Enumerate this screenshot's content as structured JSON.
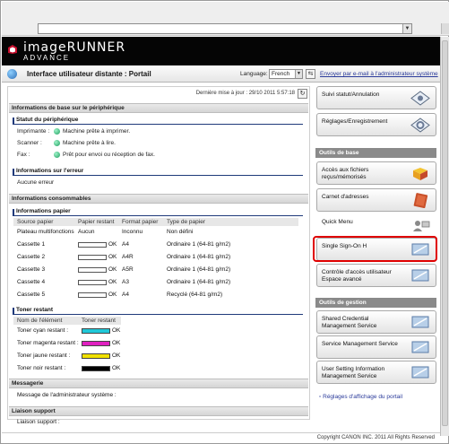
{
  "app": {
    "logo_main": "imageRUNNER",
    "logo_sub": "ADVANCE",
    "page_title": "Interface utilisateur distante : Portail",
    "language_label": "Language:",
    "language_value": "French",
    "email_link": "Envoyer par e-mail à l'administrateur système"
  },
  "left": {
    "last_update": "Dernière mise à jour : 29/10 2011 5:57:18",
    "device_info": {
      "heading": "Informations de base sur le périphérique",
      "status_heading": "Statut du périphérique",
      "rows": [
        {
          "label": "Imprimante :",
          "status": "Machine prête à imprimer."
        },
        {
          "label": "Scanner :",
          "status": "Machine prête à lire."
        },
        {
          "label": "Fax :",
          "status": "Prêt pour envoi ou réception de fax."
        }
      ],
      "error_heading": "Informations sur l'erreur",
      "error_text": "Aucune erreur"
    },
    "consumables": {
      "heading": "Informations consommables",
      "paper_heading": "Informations papier",
      "columns": [
        "Source papier",
        "Papier restant",
        "Format papier",
        "Type de papier"
      ],
      "rows": [
        {
          "source": "Plateau multifonctions",
          "remaining": "Aucun",
          "format": "Inconnu",
          "type": "Non défini",
          "level": null
        },
        {
          "source": "Cassette 1",
          "remaining": "OK",
          "format": "A4",
          "type": "Ordinaire 1 (64-81 g/m2)",
          "level": 1.0
        },
        {
          "source": "Cassette 2",
          "remaining": "OK",
          "format": "A4R",
          "type": "Ordinaire 1 (64-81 g/m2)",
          "level": 1.0
        },
        {
          "source": "Cassette 3",
          "remaining": "OK",
          "format": "A5R",
          "type": "Ordinaire 1 (64-81 g/m2)",
          "level": 1.0
        },
        {
          "source": "Cassette 4",
          "remaining": "OK",
          "format": "A3",
          "type": "Ordinaire 1 (64-81 g/m2)",
          "level": 1.0
        },
        {
          "source": "Cassette 5",
          "remaining": "OK",
          "format": "A4",
          "type": "Recyclé (64-81 g/m2)",
          "level": 1.0
        }
      ],
      "toner_heading": "Toner restant",
      "toner_columns": [
        "Nom de l'élément",
        "Toner restant"
      ],
      "toner_rows": [
        {
          "name": "Toner cyan restant :",
          "status": "OK",
          "color": "#20c8d8"
        },
        {
          "name": "Toner magenta restant :",
          "status": "OK",
          "color": "#e020c0"
        },
        {
          "name": "Toner jaune restant :",
          "status": "OK",
          "color": "#f0e000"
        },
        {
          "name": "Toner noir restant :",
          "status": "OK",
          "color": "#000000"
        }
      ]
    },
    "messaging": {
      "heading": "Messagerie",
      "text": "Message de l'administrateur système :"
    },
    "support": {
      "heading": "Liaison support",
      "text": "Liaison support :"
    }
  },
  "right": {
    "top_buttons": [
      "Suivi statut/Annulation",
      "Réglages/Enregistrement"
    ],
    "basic_heading": "Outils de base",
    "basic_buttons": [
      "Accès aux fichiers reçus/mémorisés",
      "Carnet d'adresses",
      "Quick Menu",
      "Single Sign-On H",
      "Contrôle d'accès utilisateur Espace avancé"
    ],
    "mgmt_heading": "Outils de gestion",
    "mgmt_buttons": [
      "Shared Credential Management Service",
      "Service Management Service",
      "User Setting Information Management Service"
    ],
    "settings_link": "Réglages d'affichage du portail"
  },
  "footer": {
    "copyright": "Copyright CANON INC. 2011 All Rights Reserved"
  },
  "colors": {
    "highlight": "#e00000",
    "status_ok": "#1d9c5e",
    "link": "#2a3a9a"
  }
}
